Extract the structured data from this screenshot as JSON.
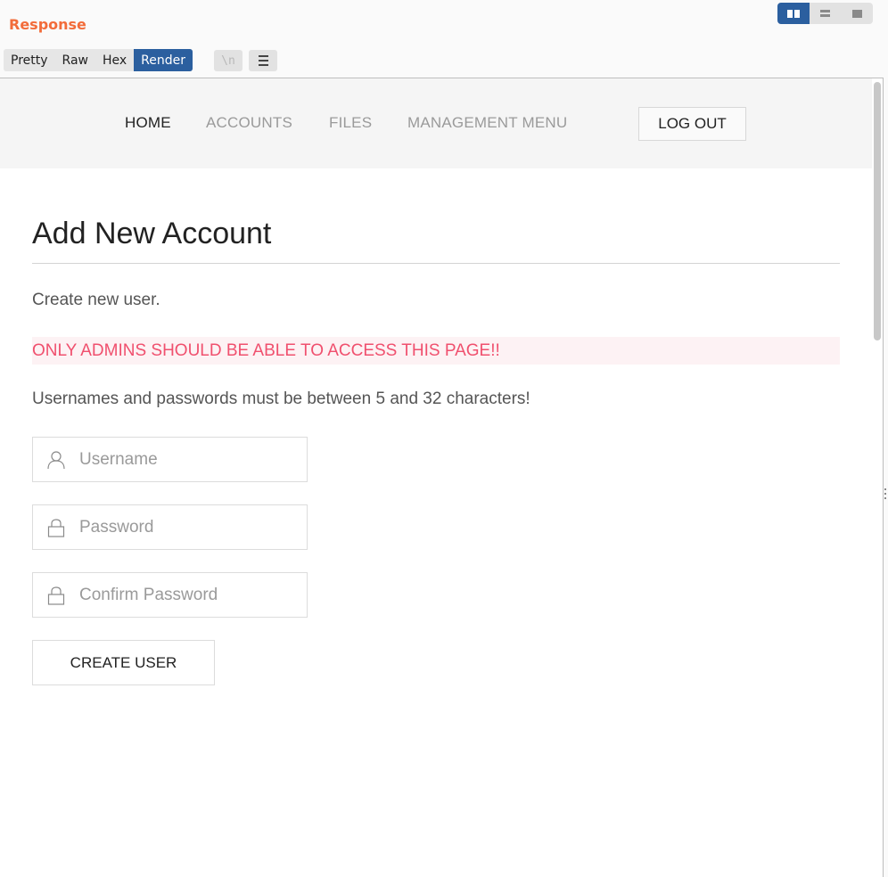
{
  "panel": {
    "title": "Response",
    "view_tabs": [
      "Pretty",
      "Raw",
      "Hex",
      "Render"
    ],
    "active_tab": "Render",
    "newline_toggle": "\\n",
    "accent_color": "#2b5f9f",
    "title_color": "#f26c3a"
  },
  "site": {
    "nav": {
      "home": "HOME",
      "accounts": "ACCOUNTS",
      "files": "FILES",
      "management": "MANAGEMENT MENU",
      "logout": "LOG OUT"
    },
    "page": {
      "heading": "Add New Account",
      "lead": "Create new user.",
      "warning": "ONLY ADMINS SHOULD BE ABLE TO ACCESS THIS PAGE!!",
      "warning_color": "#f0506e",
      "rule": "Usernames and passwords must be between 5 and 32 characters!"
    },
    "form": {
      "username_placeholder": "Username",
      "password_placeholder": "Password",
      "confirm_placeholder": "Confirm Password",
      "submit_label": "CREATE USER"
    }
  }
}
